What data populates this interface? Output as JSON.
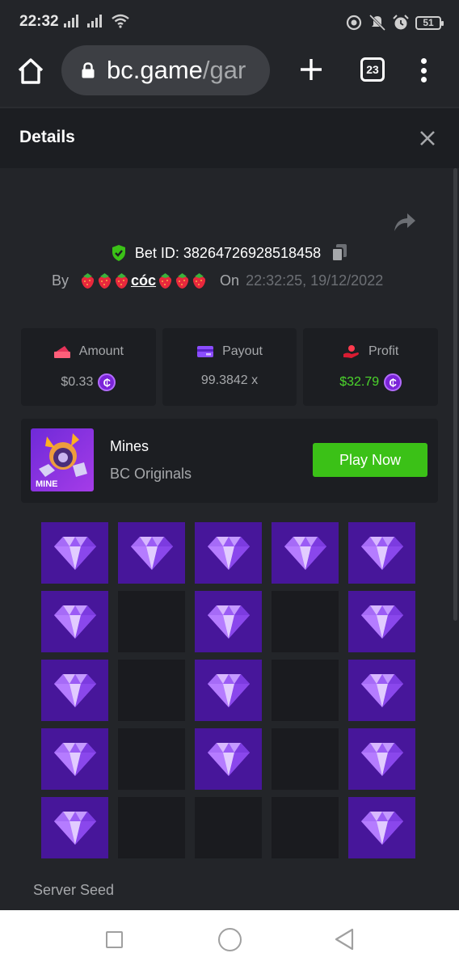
{
  "status_bar": {
    "time": "22:32",
    "battery": "51",
    "icons": [
      "signal-icon",
      "signal-icon",
      "wifi-icon",
      "data-saver-icon",
      "mute-vibrate-icon",
      "alarm-icon",
      "battery-icon"
    ]
  },
  "browser": {
    "url_host": "bc.game",
    "url_path": "/gar",
    "tab_count": "23",
    "icons": [
      "home-icon",
      "lock-icon",
      "plus-icon",
      "tabs-icon",
      "menu-icon"
    ]
  },
  "details": {
    "title": "Details",
    "close_icon": "close-icon"
  },
  "bet": {
    "bet_id_label": "Bet ID: 38264726928518458",
    "by_label": "By",
    "username": "cóc",
    "on_label": "On",
    "timestamp": "22:32:25, 19/12/2022"
  },
  "stats": [
    {
      "label": "Amount",
      "value": "$0.33",
      "icon": "amount-icon",
      "coin": true,
      "color": "#a6a8ab"
    },
    {
      "label": "Payout",
      "value": "99.3842 x",
      "icon": "payout-icon",
      "coin": false,
      "color": "#a6a8ab"
    },
    {
      "label": "Profit",
      "value": "$32.79",
      "icon": "profit-icon",
      "coin": true,
      "color": "#4cd62c"
    }
  ],
  "coin_symbol": "₵",
  "game": {
    "name": "Mines",
    "provider": "BC Originals",
    "thumb_label": "MINE",
    "play_label": "Play Now",
    "play_color": "#3bc117"
  },
  "mines_grid": [
    [
      1,
      1,
      1,
      1,
      1
    ],
    [
      1,
      0,
      1,
      0,
      1
    ],
    [
      1,
      0,
      1,
      0,
      1
    ],
    [
      1,
      0,
      1,
      0,
      1
    ],
    [
      1,
      0,
      0,
      0,
      1
    ]
  ],
  "gem_color": "#47169a",
  "server_seed_label": "Server Seed"
}
